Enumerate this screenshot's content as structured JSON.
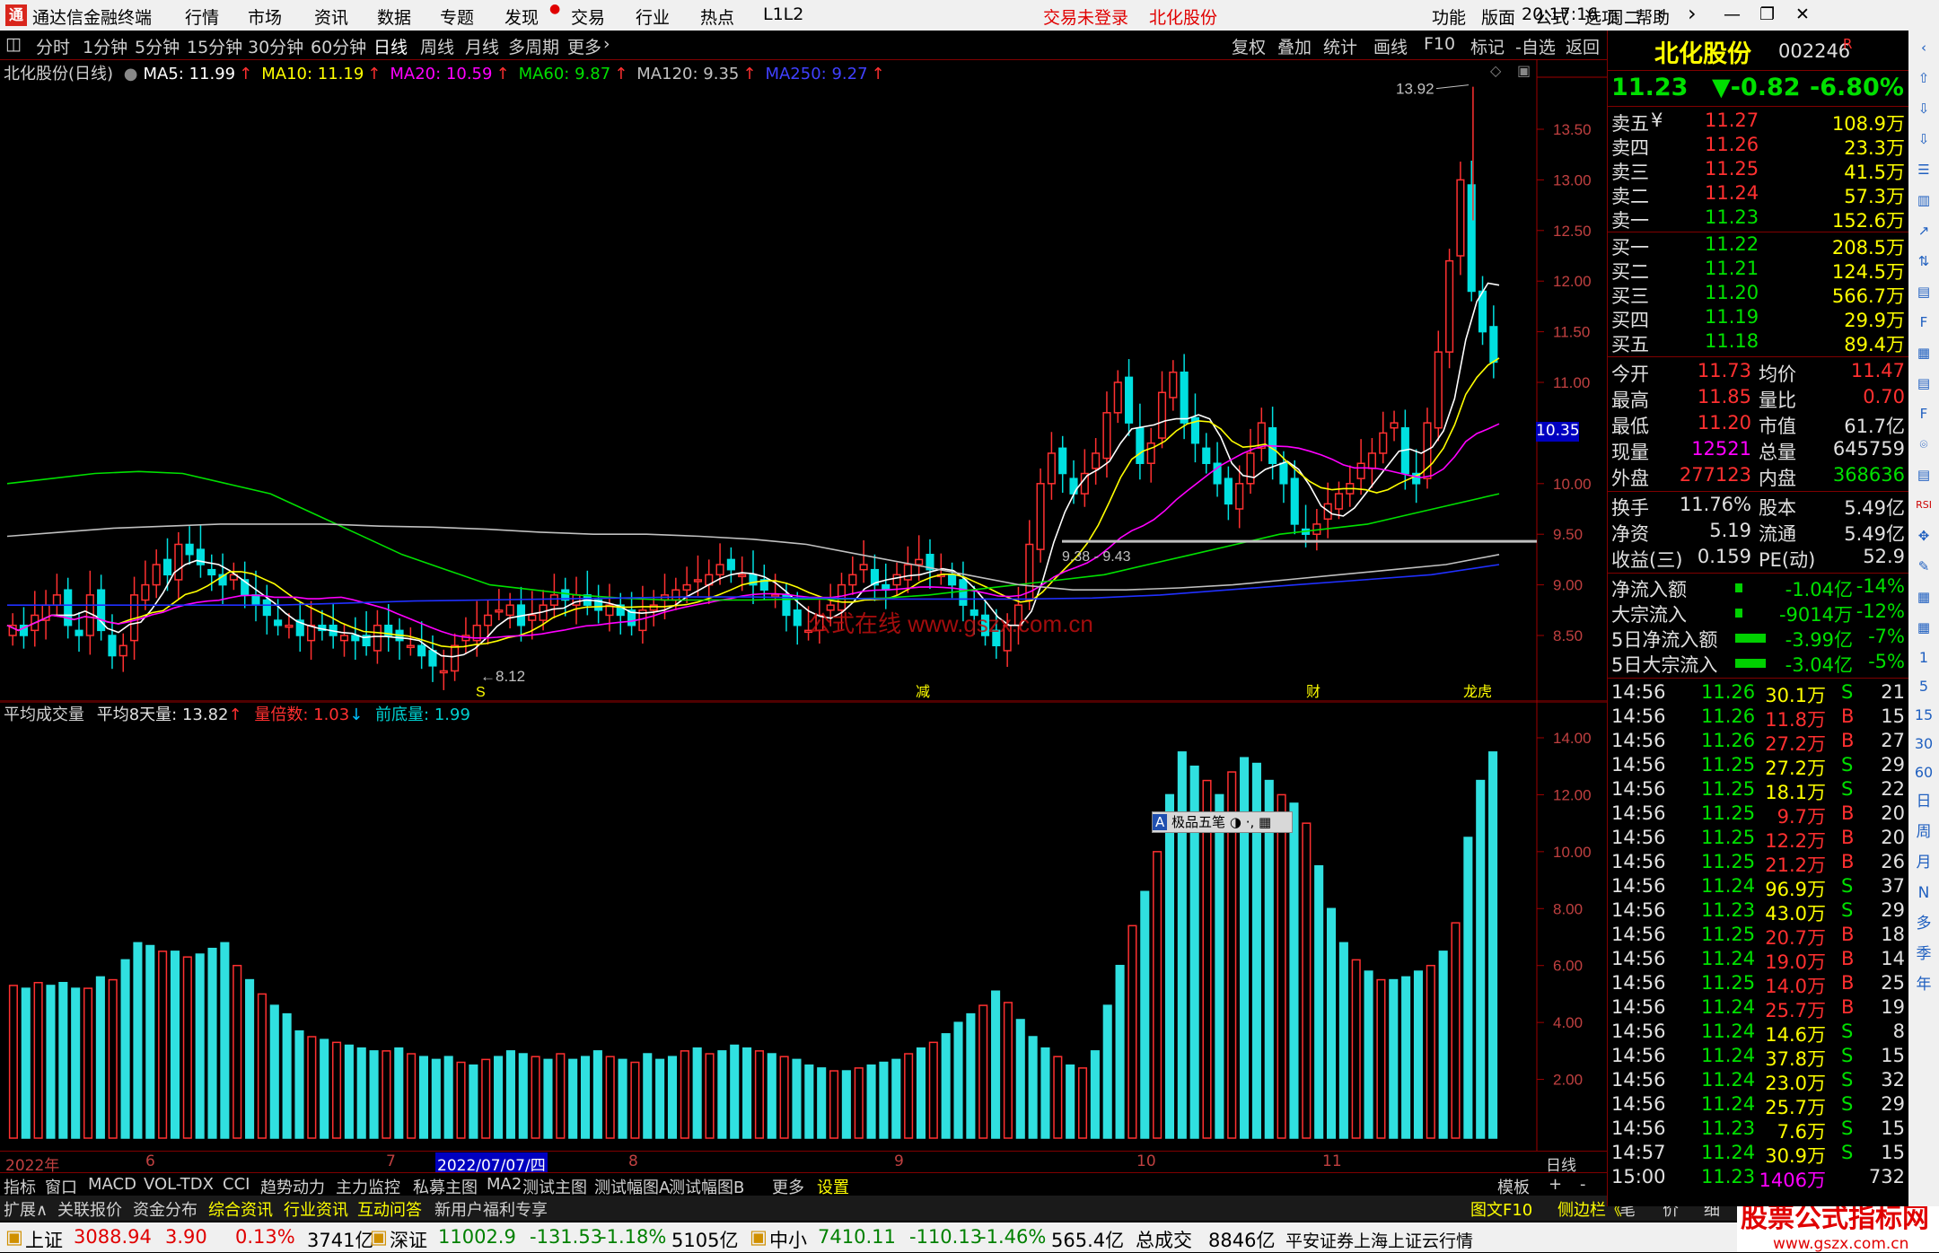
{
  "titlebar": {
    "app_name": "通达信金融终端",
    "menu": [
      "行情",
      "市场",
      "资讯",
      "数据",
      "专题",
      "发现",
      "交易",
      "行业",
      "热点",
      "L1L2"
    ],
    "trade_status": "交易未登录",
    "stock_name": "北化股份",
    "right_menu": [
      "功能",
      "版面",
      "公式",
      "选项",
      "帮助"
    ],
    "time": "20:17:16",
    "weekday": "周二"
  },
  "periods": {
    "items": [
      "分时",
      "1分钟",
      "5分钟",
      "15分钟",
      "30分钟",
      "60分钟",
      "日线",
      "周线",
      "月线",
      "多周期",
      "更多"
    ],
    "active": "日线",
    "right_items": [
      "复权",
      "叠加",
      "统计",
      "画线",
      "F10",
      "标记",
      "-自选",
      "返回"
    ]
  },
  "main_chart": {
    "title": "北化股份(日线)",
    "ma": [
      {
        "label": "MA5: 11.99",
        "color": "#ffffff"
      },
      {
        "label": "MA10: 11.19",
        "color": "#ffff00"
      },
      {
        "label": "MA20: 10.59",
        "color": "#ff00ff"
      },
      {
        "label": "MA60: 9.87",
        "color": "#00e000"
      },
      {
        "label": "MA120: 9.35",
        "color": "#c0c0c0"
      },
      {
        "label": "MA250: 9.27",
        "color": "#4040ff"
      }
    ],
    "y_ticks": [
      "13.50",
      "13.00",
      "12.50",
      "12.00",
      "11.50",
      "11.00",
      "10.00",
      "9.50",
      "9.00",
      "8.50"
    ],
    "current_price_tag": "10.35",
    "high_label": "13.92",
    "low_label": "8.12",
    "line_label": "9.38 - 9.43",
    "watermark": "公式在线    www.gszx.com.cn",
    "markers": [
      "S",
      "减",
      "财",
      "龙虎"
    ]
  },
  "vol_chart": {
    "title": "平均成交量",
    "avg8": "平均8天量: 13.82",
    "ratio": "量倍数: 1.03",
    "prev": "前底量: 1.99",
    "y_ticks": [
      "14.00",
      "12.00",
      "10.00",
      "8.00",
      "6.00",
      "4.00",
      "2.00"
    ],
    "popup": "极品五笔"
  },
  "time_axis": [
    "2022年",
    "6",
    "7",
    "2022/07/07/四",
    "8",
    "9",
    "10",
    "11",
    "日线"
  ],
  "indicator_tabs": [
    "指标",
    "窗口",
    "MACD",
    "VOL-TDX",
    "CCI",
    "趋势动力",
    "主力监控",
    "私募主图",
    "MA2",
    "测试主图",
    "测试幅图A",
    "测试幅图B",
    "更多",
    "设置"
  ],
  "indicator_right": [
    "模板",
    "+",
    "-"
  ],
  "info_tabs": [
    "扩展∧",
    "关联报价",
    "资金分布",
    "综合资讯",
    "行业资讯",
    "互动问答",
    "新用户福利专享"
  ],
  "info_right": [
    "图文F10",
    "侧边栏《",
    "笔",
    "价",
    "细",
    "势"
  ],
  "quote": {
    "name": "北化股份",
    "code": "002246",
    "suffix": "R",
    "price": "11.23",
    "change": "▼-0.82",
    "pct": "-6.80%",
    "asks": [
      {
        "label": "卖五",
        "price": "11.27",
        "vol": "108.9万"
      },
      {
        "label": "卖四",
        "price": "11.26",
        "vol": "23.3万"
      },
      {
        "label": "卖三",
        "price": "11.25",
        "vol": "41.5万"
      },
      {
        "label": "卖二",
        "price": "11.24",
        "vol": "57.3万"
      },
      {
        "label": "卖一",
        "price": "11.23",
        "vol": "152.6万"
      }
    ],
    "ask_currency": "¥",
    "bids": [
      {
        "label": "买一",
        "price": "11.22",
        "vol": "208.5万"
      },
      {
        "label": "买二",
        "price": "11.21",
        "vol": "124.5万"
      },
      {
        "label": "买三",
        "price": "11.20",
        "vol": "566.7万"
      },
      {
        "label": "买四",
        "price": "11.19",
        "vol": "29.9万"
      },
      {
        "label": "买五",
        "price": "11.18",
        "vol": "89.4万"
      }
    ],
    "stats": [
      {
        "l1": "今开",
        "v1": "11.73",
        "c1": "r",
        "l2": "均价",
        "v2": "11.47",
        "c2": "r"
      },
      {
        "l1": "最高",
        "v1": "11.85",
        "c1": "r",
        "l2": "量比",
        "v2": "0.70",
        "c2": "r"
      },
      {
        "l1": "最低",
        "v1": "11.20",
        "c1": "r",
        "l2": "市值",
        "v2": "61.7亿",
        "c2": "w"
      },
      {
        "l1": "现量",
        "v1": "12521",
        "c1": "m",
        "l2": "总量",
        "v2": "645759",
        "c2": "w"
      },
      {
        "l1": "外盘",
        "v1": "277123",
        "c1": "r",
        "l2": "内盘",
        "v2": "368636",
        "c2": "g"
      }
    ],
    "stats2": [
      {
        "l1": "换手",
        "v1": "11.76%",
        "l2": "股本",
        "v2": "5.49亿"
      },
      {
        "l1": "净资",
        "v1": "5.19",
        "l2": "流通",
        "v2": "5.49亿"
      },
      {
        "l1": "收益(三)",
        "v1": "0.159",
        "l2": "PE(动)",
        "v2": "52.9"
      }
    ],
    "flows": [
      {
        "label": "净流入额",
        "val": "-1.04亿",
        "pct": "-14%"
      },
      {
        "label": "大宗流入",
        "val": "-9014万",
        "pct": "-12%"
      },
      {
        "label": "5日净流入额",
        "val": "-3.99亿",
        "pct": "-7%"
      },
      {
        "label": "5日大宗流入",
        "val": "-3.04亿",
        "pct": "-5%"
      }
    ],
    "ticks": [
      {
        "t": "14:56",
        "p": "11.26",
        "v": "30.1万",
        "s": "S",
        "n": "21"
      },
      {
        "t": "14:56",
        "p": "11.26",
        "v": "11.8万",
        "s": "B",
        "n": "15"
      },
      {
        "t": "14:56",
        "p": "11.26",
        "v": "27.2万",
        "s": "B",
        "n": "27"
      },
      {
        "t": "14:56",
        "p": "11.25",
        "v": "27.2万",
        "s": "S",
        "n": "29"
      },
      {
        "t": "14:56",
        "p": "11.25",
        "v": "18.1万",
        "s": "S",
        "n": "22"
      },
      {
        "t": "14:56",
        "p": "11.25",
        "v": "9.7万",
        "s": "B",
        "n": "20"
      },
      {
        "t": "14:56",
        "p": "11.25",
        "v": "12.2万",
        "s": "B",
        "n": "20"
      },
      {
        "t": "14:56",
        "p": "11.25",
        "v": "21.2万",
        "s": "B",
        "n": "26"
      },
      {
        "t": "14:56",
        "p": "11.24",
        "v": "96.9万",
        "s": "S",
        "n": "37"
      },
      {
        "t": "14:56",
        "p": "11.23",
        "v": "43.0万",
        "s": "S",
        "n": "29"
      },
      {
        "t": "14:56",
        "p": "11.25",
        "v": "20.7万",
        "s": "B",
        "n": "18"
      },
      {
        "t": "14:56",
        "p": "11.24",
        "v": "19.0万",
        "s": "B",
        "n": "14"
      },
      {
        "t": "14:56",
        "p": "11.25",
        "v": "14.0万",
        "s": "B",
        "n": "25"
      },
      {
        "t": "14:56",
        "p": "11.24",
        "v": "25.7万",
        "s": "B",
        "n": "19"
      },
      {
        "t": "14:56",
        "p": "11.24",
        "v": "14.6万",
        "s": "S",
        "n": "8"
      },
      {
        "t": "14:56",
        "p": "11.24",
        "v": "37.8万",
        "s": "S",
        "n": "15"
      },
      {
        "t": "14:56",
        "p": "11.24",
        "v": "23.0万",
        "s": "S",
        "n": "32"
      },
      {
        "t": "14:56",
        "p": "11.24",
        "v": "25.7万",
        "s": "S",
        "n": "29"
      },
      {
        "t": "14:56",
        "p": "11.23",
        "v": "7.6万",
        "s": "S",
        "n": "15"
      },
      {
        "t": "14:57",
        "p": "11.24",
        "v": "30.9万",
        "s": "S",
        "n": "15"
      },
      {
        "t": "15:00",
        "p": "11.23",
        "v": "1406万",
        "s": "",
        "n": "732"
      }
    ]
  },
  "sidebar_items": [
    "日",
    "周",
    "月",
    "N",
    "多",
    "季",
    "年"
  ],
  "sidebar_nums": [
    "1",
    "5",
    "15",
    "30",
    "60"
  ],
  "statusbar": {
    "items": [
      {
        "name": "上证",
        "price": "3088.94",
        "chg": "3.90",
        "pct": "0.13%",
        "amt": "3741亿",
        "up": true
      },
      {
        "name": "深证",
        "price": "11002.9",
        "chg": "-131.53",
        "pct": "-1.18%",
        "amt": "5105亿",
        "up": false
      },
      {
        "name": "中小",
        "price": "7410.11",
        "chg": "-110.13",
        "pct": "-1.46%",
        "amt": "565.4亿",
        "up": false
      }
    ],
    "total_label": "总成交",
    "total": "8846亿",
    "broker": "平安证券上海上证云行情",
    "brand": "股票公式指标网",
    "brand_url": "www.gszx.com.cn"
  }
}
